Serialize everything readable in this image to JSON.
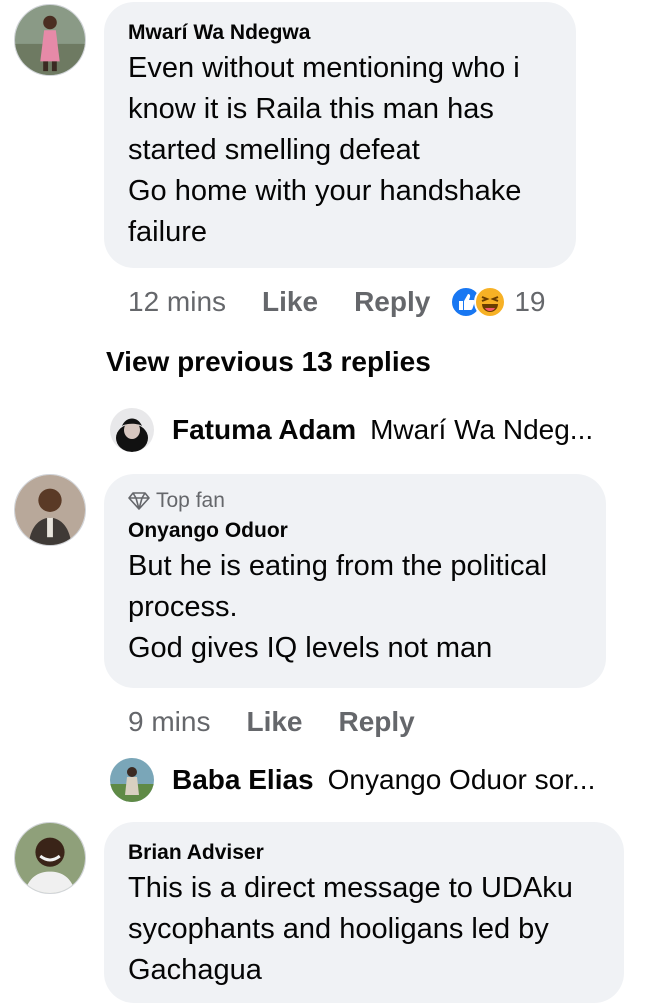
{
  "comments": [
    {
      "author": "Mwarí Wa Ndegwa",
      "text": "Even without mentioning who i\nknow it is Raila this man has\nstarted smelling defeat\nGo home with your handshake\nfailure",
      "time": "12 mins",
      "like_label": "Like",
      "reply_label": "Reply",
      "reaction_count": "19",
      "reaction_icons": [
        "like-reaction-icon",
        "haha-reaction-icon"
      ]
    },
    {
      "badge": "Top fan",
      "badge_icon": "diamond-icon",
      "author": "Onyango Oduor",
      "text": "But he is eating from the political\nprocess.\nGod gives IQ levels not man",
      "time": "9 mins",
      "like_label": "Like",
      "reply_label": "Reply"
    },
    {
      "author": "Brian Adviser",
      "text": "This is a direct message to UDAku\nsycophants and hooligans led by\nGachagua"
    }
  ],
  "view_previous_replies": "View previous 13 replies",
  "reply_previews": [
    {
      "name": "Fatuma Adam",
      "snippet": "Mwarí Wa Ndeg..."
    },
    {
      "name": "Baba Elias",
      "snippet": "Onyango Oduor sor..."
    }
  ],
  "colors": {
    "bubble_bg": "#f0f2f5",
    "meta_text": "#65676b",
    "like_blue": "#1877f2",
    "haha_yellow": "#f7b125"
  }
}
